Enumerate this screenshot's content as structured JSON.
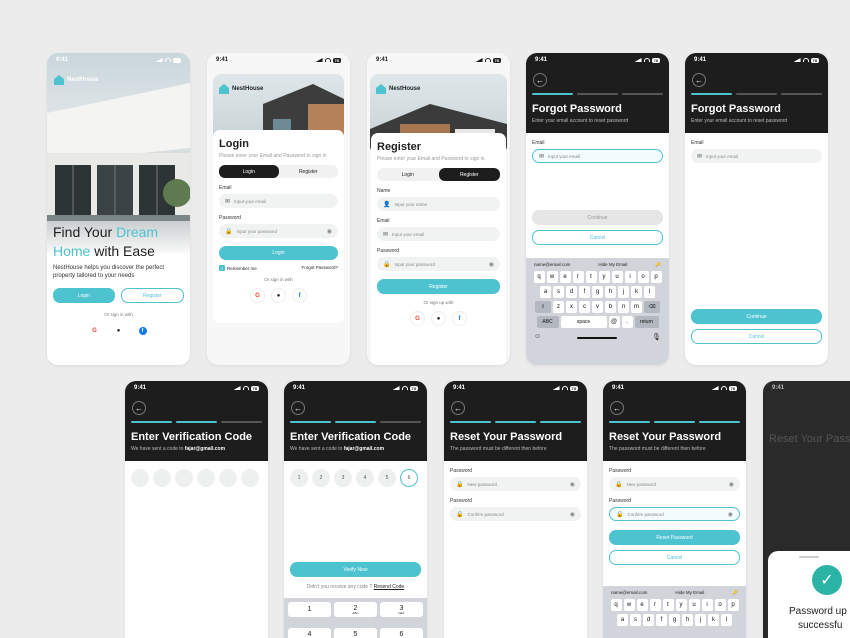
{
  "status": {
    "time": "9:41",
    "battery": "78"
  },
  "brand": "NestHouse",
  "onboard": {
    "title_a": "Find Your ",
    "title_b": "Dream",
    "title_c": "Home",
    "title_d": " with Ease",
    "desc": "NestHouse helps you discover the perfect property tailored to your needs",
    "login": "Login",
    "register": "Register",
    "or": "Or sign in with"
  },
  "login": {
    "title": "Login",
    "sub": "Please enter your Email and Password to sign in",
    "tab_login": "Login",
    "tab_register": "Register",
    "email_label": "Email",
    "email_ph": "Input your email",
    "pwd_label": "Password",
    "pwd_ph": "Input your password",
    "btn": "Login",
    "remember": "Remember me",
    "forgot": "Forgot Password?",
    "or": "Or sign in with"
  },
  "register": {
    "title": "Register",
    "sub": "Please enter your Email and Password to sign in",
    "tab_login": "Login",
    "tab_register": "Register",
    "name_label": "Name",
    "name_ph": "Input your name",
    "email_label": "Email",
    "email_ph": "Input your email",
    "pwd_label": "Password",
    "pwd_ph": "Input your password",
    "btn": "Register",
    "or": "Or sign up with"
  },
  "forgot": {
    "title": "Forgot Password",
    "sub": "Enter your email account to reset password",
    "email_label": "Email",
    "email_ph": "Input your email",
    "continue": "Continue",
    "cancel": "Cancel"
  },
  "keyboard": {
    "suggest_email": "name@email.com",
    "hide": "Hide My Email",
    "row1": [
      "q",
      "w",
      "e",
      "r",
      "t",
      "y",
      "u",
      "i",
      "o",
      "p"
    ],
    "row2": [
      "a",
      "s",
      "d",
      "f",
      "g",
      "h",
      "j",
      "k",
      "l"
    ],
    "row3": [
      "z",
      "x",
      "c",
      "v",
      "b",
      "n",
      "m"
    ],
    "abc": "ABC",
    "space": "space",
    "at": "@",
    "dot": ".",
    "ret": "return"
  },
  "verify": {
    "title": "Enter Verification Code",
    "sub": "We have sent a code to",
    "email": "fajar@gmail.com",
    "digits": [
      "1",
      "2",
      "3",
      "4",
      "5",
      "6"
    ],
    "btn": "Verify Now",
    "resend_q": "Didn't you receive any code ?",
    "resend": "Resend Code",
    "numpad": [
      {
        "n": "1",
        "l": ""
      },
      {
        "n": "2",
        "l": "ABC"
      },
      {
        "n": "3",
        "l": "DEF"
      },
      {
        "n": "4",
        "l": "GHI"
      },
      {
        "n": "5",
        "l": "JKL"
      },
      {
        "n": "6",
        "l": "MNO"
      }
    ]
  },
  "reset": {
    "title": "Reset Your Password",
    "sub": "The password must be different then before",
    "pwd_label": "Password",
    "new_ph": "New password",
    "confirm_label": "Password",
    "confirm_ph": "Confirm password",
    "btn": "Reset Password",
    "cancel": "Cancel"
  },
  "success": {
    "text_a": "Password up",
    "text_b": "successfu"
  },
  "colors": {
    "accent": "#4dc3cf",
    "dark": "#1d1d1d"
  }
}
